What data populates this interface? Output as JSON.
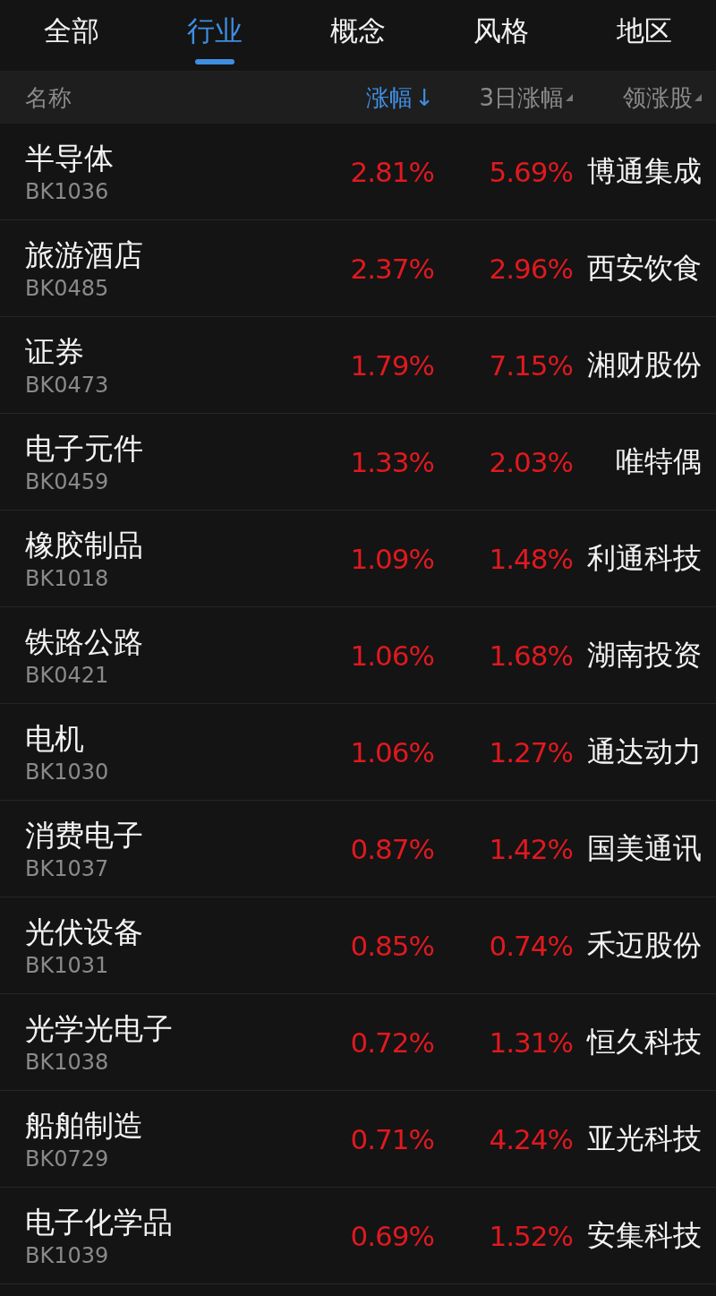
{
  "tabs": [
    {
      "label": "全部",
      "selected": false
    },
    {
      "label": "行业",
      "selected": true
    },
    {
      "label": "概念",
      "selected": false
    },
    {
      "label": "风格",
      "selected": false
    },
    {
      "label": "地区",
      "selected": false
    }
  ],
  "table": {
    "columns": [
      {
        "label": "名称",
        "kind": "plain"
      },
      {
        "label": "涨幅",
        "kind": "sort",
        "selected": true,
        "arrow": "↓"
      },
      {
        "label": "3日涨幅",
        "kind": "sort",
        "selected": false
      },
      {
        "label": "领涨股",
        "kind": "sort",
        "selected": false
      }
    ],
    "rows": [
      {
        "name": "半导体",
        "code": "BK1036",
        "change": "2.81%",
        "change_3d": "5.69%",
        "leader": "博通集成"
      },
      {
        "name": "旅游酒店",
        "code": "BK0485",
        "change": "2.37%",
        "change_3d": "2.96%",
        "leader": "西安饮食"
      },
      {
        "name": "证券",
        "code": "BK0473",
        "change": "1.79%",
        "change_3d": "7.15%",
        "leader": "湘财股份"
      },
      {
        "name": "电子元件",
        "code": "BK0459",
        "change": "1.33%",
        "change_3d": "2.03%",
        "leader": "唯特偶"
      },
      {
        "name": "橡胶制品",
        "code": "BK1018",
        "change": "1.09%",
        "change_3d": "1.48%",
        "leader": "利通科技"
      },
      {
        "name": "铁路公路",
        "code": "BK0421",
        "change": "1.06%",
        "change_3d": "1.68%",
        "leader": "湖南投资"
      },
      {
        "name": "电机",
        "code": "BK1030",
        "change": "1.06%",
        "change_3d": "1.27%",
        "leader": "通达动力"
      },
      {
        "name": "消费电子",
        "code": "BK1037",
        "change": "0.87%",
        "change_3d": "1.42%",
        "leader": "国美通讯"
      },
      {
        "name": "光伏设备",
        "code": "BK1031",
        "change": "0.85%",
        "change_3d": "0.74%",
        "leader": "禾迈股份"
      },
      {
        "name": "光学光电子",
        "code": "BK1038",
        "change": "0.72%",
        "change_3d": "1.31%",
        "leader": "恒久科技"
      },
      {
        "name": "船舶制造",
        "code": "BK0729",
        "change": "0.71%",
        "change_3d": "4.24%",
        "leader": "亚光科技"
      },
      {
        "name": "电子化学品",
        "code": "BK1039",
        "change": "0.69%",
        "change_3d": "1.52%",
        "leader": "安集科技"
      }
    ]
  }
}
